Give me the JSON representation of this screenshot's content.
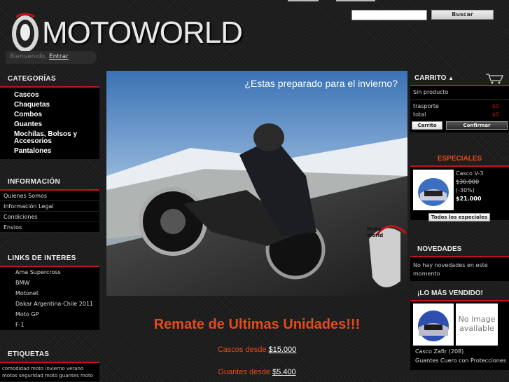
{
  "header": {
    "logo_text": "MOTOWORLD",
    "welcome_text": "Bienvenido,",
    "login_link": "Entrar",
    "search_button": "Buscar",
    "search_value": ""
  },
  "left": {
    "categories_title": "CATEGORÍAS",
    "categories": [
      "Cascos",
      "Chaquetas",
      "Combos",
      "Guantes",
      "Mochilas, Bolsos y Accesorios",
      "Pantalones"
    ],
    "info_title": "INFORMACIÓN",
    "info_items": [
      "Quienes Somos",
      "Información Legal",
      "Condiciones",
      "Envios"
    ],
    "links_title": "LINKS DE INTERES",
    "links": [
      "Ama Supercross",
      "BMW",
      "Motonet",
      "Dakar Argentina-Chile 2011",
      "Moto GP",
      "F-1"
    ],
    "tags_title": "ETIQUETAS",
    "tags_line1": "comodidad  moto  invierno  verano",
    "tags_line2": "motos seguridad  moto guantes  moto"
  },
  "center": {
    "banner_caption": "¿Estas preparado para el invierno?",
    "banner_logo": "Moto World",
    "promo_title": "Remate de Ultimas Unidades!!!",
    "promo_1_text": "Cascos desde ",
    "promo_1_price": "$15.000",
    "promo_2_text": "Guantes desde ",
    "promo_2_price": "$5.400"
  },
  "right": {
    "cart_title": "CARRITO",
    "cart_empty": "Sin producto",
    "shipping_label": "trasporte",
    "shipping_value": "$0",
    "total_label": "total",
    "total_value": "$0",
    "cart_button": "Carrito",
    "confirm_button": "Confirmar",
    "specials_title": "ESPECIALES",
    "special_name": "Casco V-3",
    "special_old_price": "$30.000",
    "special_discount": "(-30%)",
    "special_price": "$21.000",
    "specials_button": "Todos los especiales",
    "news_title": "NOVEDADES",
    "news_text": "No hay novedades en este momento",
    "best_title": "¡LO MÁS VENDIDO!",
    "no_image_text": "No image available",
    "best_1": "Casco Zafir (208)",
    "best_2": "Guantes Cuero con Protecciones"
  },
  "colors": {
    "accent_red": "#c0141a",
    "promo_orange": "#e64a19"
  }
}
